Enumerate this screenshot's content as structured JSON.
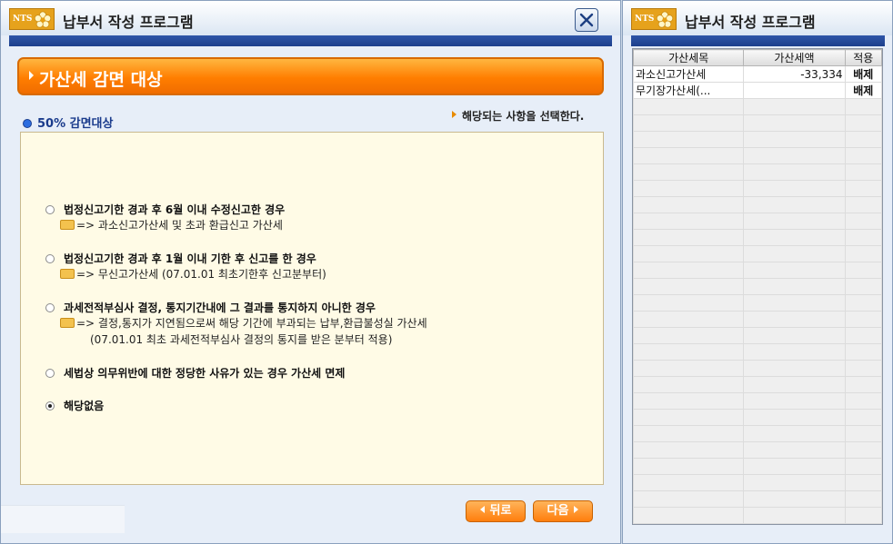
{
  "left_window": {
    "logo_text": "NTS",
    "title": "납부서 작성 프로그램",
    "section_title": "가산세 감면 대상",
    "subheading": "50% 감면대상",
    "instruction": "해당되는 사항을 선택한다.",
    "options": [
      {
        "label": "법정신고기한 경과 후 6월 이내 수정신고한 경우",
        "note": "=> 과소신고가산세 및 초과 환급신고 가산세",
        "checked": false
      },
      {
        "label": "법정신고기한 경과 후 1월 이내 기한 후 신고를 한 경우",
        "note": "=> 무신고가산세 (07.01.01 최초기한후 신고분부터)",
        "checked": false
      },
      {
        "label": "과세전적부심사 결정, 통지기간내에 그 결과를 통지하지 아니한 경우",
        "note": "=> 결정,통지가 지연됨으로써 해당 기간에 부과되는 납부,환급불성실 가산세",
        "note2": "(07.01.01 최초 과세전적부심사  결정의 통지를 받은 분부터 적용)",
        "checked": false
      },
      {
        "label": "세법상 의무위반에 대한 정당한 사유가 있는 경우 가산세 면제",
        "checked": false
      },
      {
        "label": "해당없음",
        "checked": true
      }
    ],
    "back_label": "뒤로",
    "next_label": "다음"
  },
  "right_window": {
    "logo_text": "NTS",
    "title": "납부서 작성 프로그램",
    "table": {
      "headers": [
        "가산세목",
        "가산세액",
        "적용"
      ],
      "rows": [
        [
          "과소신고가산세",
          "-33,334",
          "배제"
        ],
        [
          "무기장가산세(...",
          "",
          "배제"
        ]
      ],
      "empty_rows": 26
    }
  },
  "colors": {
    "accent_orange": "#ff8c1a",
    "title_bar_blue": "#1c3f8c",
    "panel_bg": "#fffbe6"
  }
}
